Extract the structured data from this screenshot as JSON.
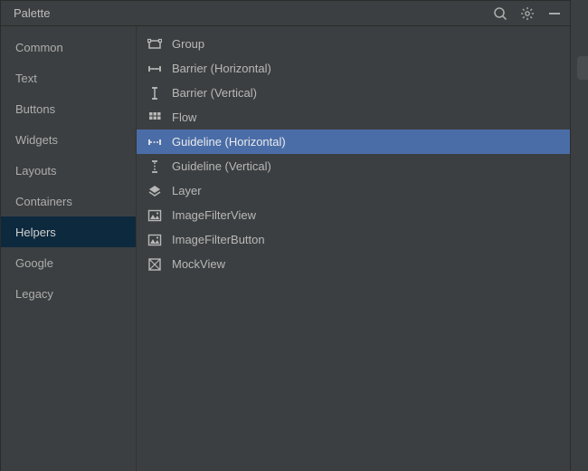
{
  "header": {
    "title": "Palette"
  },
  "sidebar": {
    "items": [
      {
        "label": "Common",
        "active": false
      },
      {
        "label": "Text",
        "active": false
      },
      {
        "label": "Buttons",
        "active": false
      },
      {
        "label": "Widgets",
        "active": false
      },
      {
        "label": "Layouts",
        "active": false
      },
      {
        "label": "Containers",
        "active": false
      },
      {
        "label": "Helpers",
        "active": true
      },
      {
        "label": "Google",
        "active": false
      },
      {
        "label": "Legacy",
        "active": false
      }
    ]
  },
  "list": {
    "items": [
      {
        "icon": "group-icon",
        "label": "Group",
        "selected": false
      },
      {
        "icon": "barrier-horizontal-icon",
        "label": "Barrier (Horizontal)",
        "selected": false
      },
      {
        "icon": "barrier-vertical-icon",
        "label": "Barrier (Vertical)",
        "selected": false
      },
      {
        "icon": "flow-icon",
        "label": "Flow",
        "selected": false
      },
      {
        "icon": "guideline-horizontal-icon",
        "label": "Guideline (Horizontal)",
        "selected": true
      },
      {
        "icon": "guideline-vertical-icon",
        "label": "Guideline (Vertical)",
        "selected": false
      },
      {
        "icon": "layer-icon",
        "label": "Layer",
        "selected": false
      },
      {
        "icon": "image-filter-view-icon",
        "label": "ImageFilterView",
        "selected": false
      },
      {
        "icon": "image-filter-button-icon",
        "label": "ImageFilterButton",
        "selected": false
      },
      {
        "icon": "mockview-icon",
        "label": "MockView",
        "selected": false
      }
    ]
  }
}
